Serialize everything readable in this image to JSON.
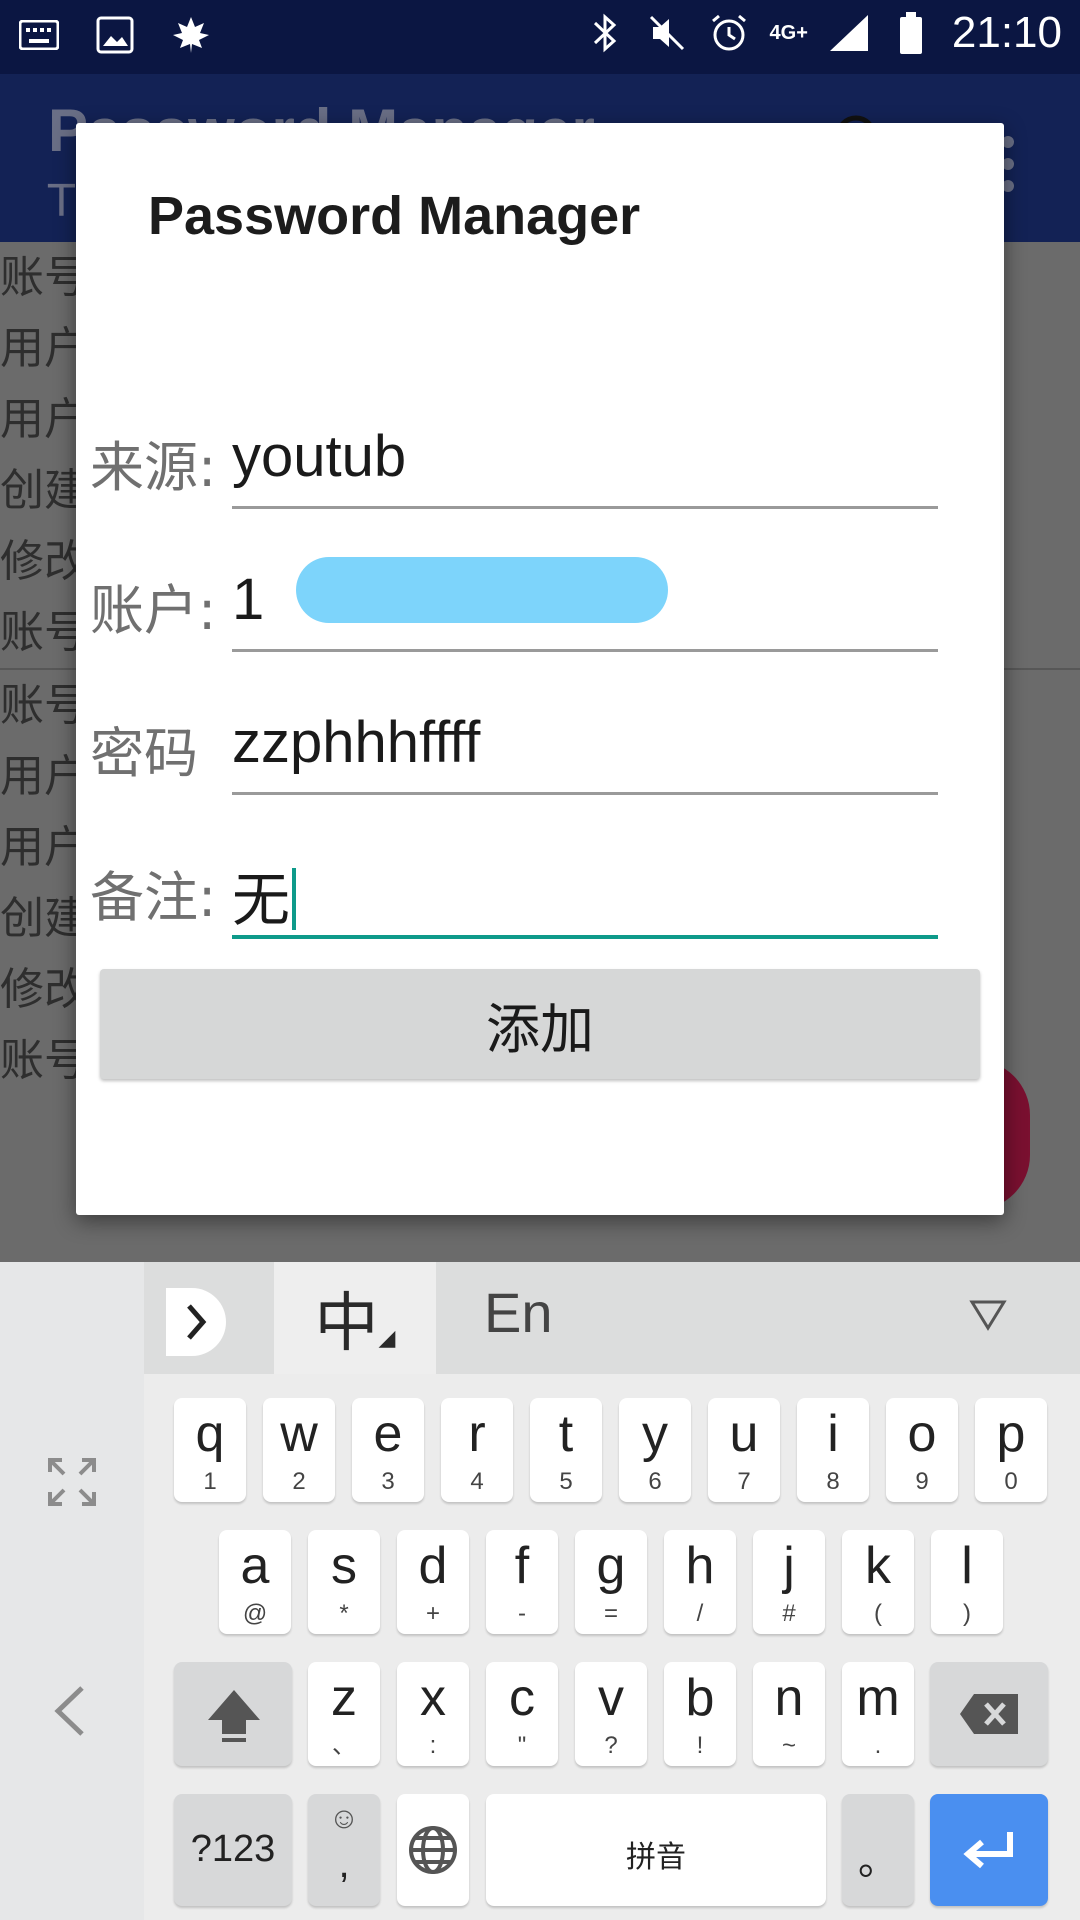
{
  "status_bar": {
    "time": "21:10",
    "network": "4G+"
  },
  "app": {
    "title": "Password Manager",
    "subtitle": "T"
  },
  "background_list": {
    "rows": [
      "账号",
      "用户",
      "用户",
      "创建",
      "修改",
      "账号",
      "账号",
      "用户",
      "用户",
      "创建",
      "修改",
      "账号"
    ]
  },
  "dialog": {
    "title": "Password Manager",
    "fields": [
      {
        "label": "来源:",
        "value": "youtub"
      },
      {
        "label": "账户:",
        "value": "1"
      },
      {
        "label": "密码",
        "value": "zzphhhffff"
      },
      {
        "label": "备注:",
        "value": "无"
      }
    ],
    "add_button": "添加"
  },
  "keyboard": {
    "lang_zh": "中",
    "lang_en": "En",
    "row1": [
      {
        "k": "q",
        "s": "1"
      },
      {
        "k": "w",
        "s": "2"
      },
      {
        "k": "e",
        "s": "3"
      },
      {
        "k": "r",
        "s": "4"
      },
      {
        "k": "t",
        "s": "5"
      },
      {
        "k": "y",
        "s": "6"
      },
      {
        "k": "u",
        "s": "7"
      },
      {
        "k": "i",
        "s": "8"
      },
      {
        "k": "o",
        "s": "9"
      },
      {
        "k": "p",
        "s": "0"
      }
    ],
    "row2": [
      {
        "k": "a",
        "s": "@"
      },
      {
        "k": "s",
        "s": "*"
      },
      {
        "k": "d",
        "s": "+"
      },
      {
        "k": "f",
        "s": "-"
      },
      {
        "k": "g",
        "s": "="
      },
      {
        "k": "h",
        "s": "/"
      },
      {
        "k": "j",
        "s": "#"
      },
      {
        "k": "k",
        "s": "("
      },
      {
        "k": "l",
        "s": ")"
      }
    ],
    "row3": [
      {
        "k": "z",
        "s": "、"
      },
      {
        "k": "x",
        "s": ":"
      },
      {
        "k": "c",
        "s": "\""
      },
      {
        "k": "v",
        "s": "?"
      },
      {
        "k": "b",
        "s": "!"
      },
      {
        "k": "n",
        "s": "~"
      },
      {
        "k": "m",
        "s": "."
      }
    ],
    "symbols_key": "?123",
    "comma_key": ",",
    "space_key": "拼音",
    "period_key": "。"
  },
  "colors": {
    "accent": "#0e9a8a",
    "enter": "#4a8ff0",
    "status_bar": "#0b1642"
  }
}
